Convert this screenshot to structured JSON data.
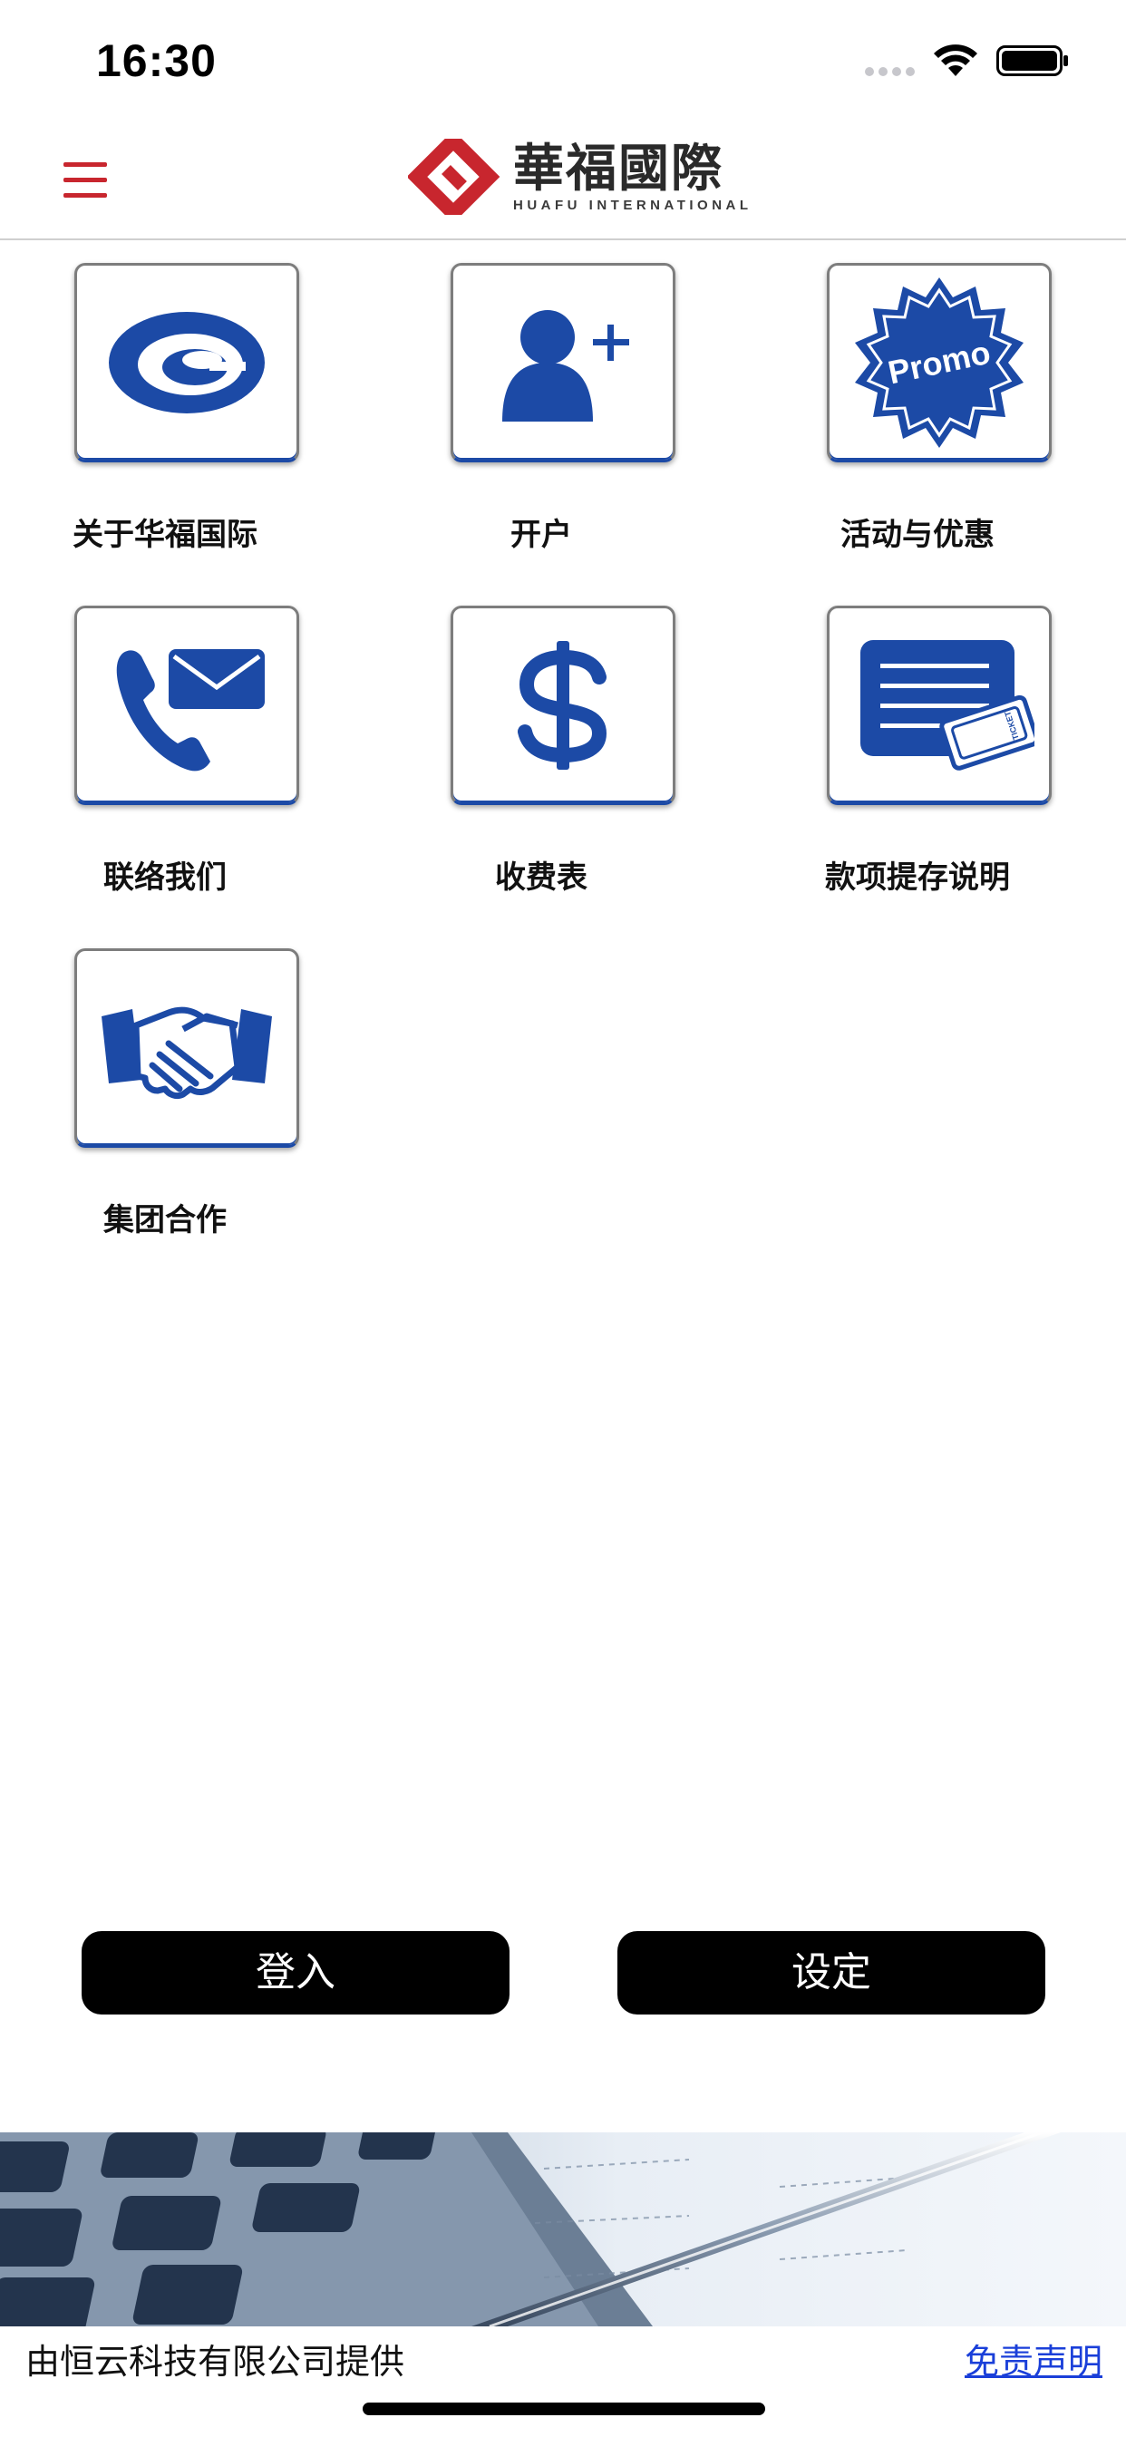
{
  "status_bar": {
    "time": "16:30"
  },
  "header": {
    "logo_cn": "華福國際",
    "logo_en": "HUAFU INTERNATIONAL"
  },
  "tiles": [
    {
      "label": "关于华福国际",
      "icon": "company-logo-icon"
    },
    {
      "label": "开户",
      "icon": "add-user-icon"
    },
    {
      "label": "活动与优惠",
      "icon": "promo-badge-icon",
      "badge_text": "Promo"
    },
    {
      "label": "联络我们",
      "icon": "phone-mail-icon"
    },
    {
      "label": "收费表",
      "icon": "dollar-icon"
    },
    {
      "label": "款项提存说明",
      "icon": "card-ticket-icon",
      "ticket_text": "TICKET"
    },
    {
      "label": "集团合作",
      "icon": "handshake-icon"
    }
  ],
  "buttons": {
    "login": "登入",
    "settings": "设定"
  },
  "footer": {
    "provider": "由恒云科技有限公司提供",
    "disclaimer": "免责声明"
  },
  "colors": {
    "brand_red": "#c8262e",
    "icon_blue": "#1c4aa6",
    "link_blue": "#1a3fd9"
  }
}
